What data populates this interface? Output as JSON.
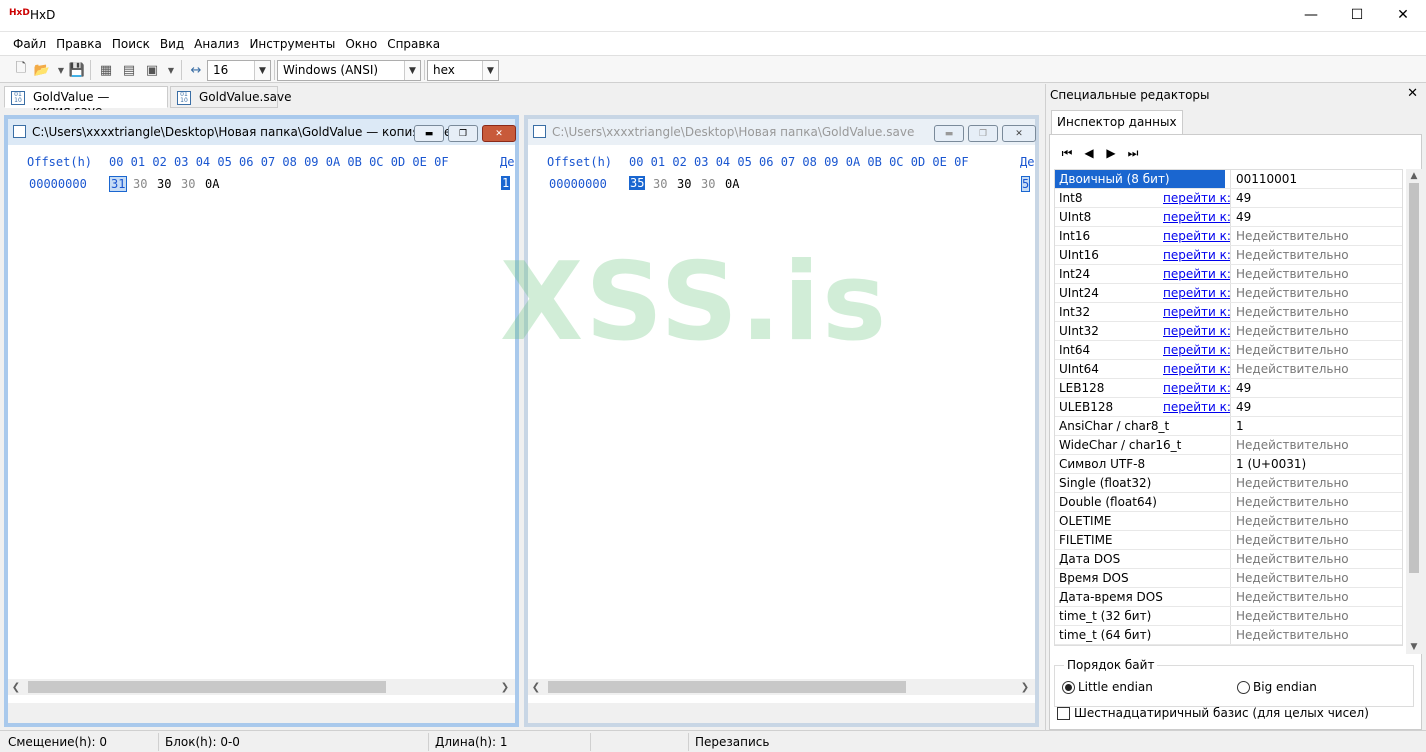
{
  "app": {
    "title": "HxD",
    "icon": "hxd-app-icon"
  },
  "window_controls": {
    "minimize": "—",
    "maximize": "☐",
    "close": "✕"
  },
  "menu": [
    "Файл",
    "Правка",
    "Поиск",
    "Вид",
    "Анализ",
    "Инструменты",
    "Окно",
    "Справка"
  ],
  "toolbar": {
    "bytes_per_row": "16",
    "charset": "Windows (ANSI)",
    "offset_base": "hex"
  },
  "tabs": [
    {
      "label": "GoldValue — копия.save",
      "active": true
    },
    {
      "label": "GoldValue.save",
      "active": false
    }
  ],
  "editors": [
    {
      "path": "C:\\Users\\xxxxtriangle\\Desktop\\Новая папка\\GoldValue — копия.save",
      "header_offset": "Offset(h)",
      "header_cols": "00 01 02 03 04 05 06 07 08 09 0A 0B 0C 0D 0E 0F",
      "header_decoded": "Де",
      "row_offset": "00000000",
      "bytes": [
        "31",
        "30",
        "30",
        "30",
        "0A"
      ],
      "decoded_cursor": "1"
    },
    {
      "path": "C:\\Users\\xxxxtriangle\\Desktop\\Новая папка\\GoldValue.save",
      "header_offset": "Offset(h)",
      "header_cols": "00 01 02 03 04 05 06 07 08 09 0A 0B 0C 0D 0E 0F",
      "header_decoded": "Де",
      "row_offset": "00000000",
      "bytes": [
        "35",
        "30",
        "30",
        "30",
        "0A"
      ],
      "decoded_cursor": "5"
    }
  ],
  "watermark": "XSS.is",
  "right_panel": {
    "title": "Специальные редакторы",
    "close": "✕",
    "tab": "Инспектор данных",
    "goto_label": "перейти к:",
    "rows": [
      {
        "name": "Двоичный (8 бит)",
        "value": "00110001",
        "goto": false,
        "selected": true
      },
      {
        "name": "Int8",
        "value": "49",
        "goto": true
      },
      {
        "name": "UInt8",
        "value": "49",
        "goto": true
      },
      {
        "name": "Int16",
        "value": "Недействительно",
        "goto": true
      },
      {
        "name": "UInt16",
        "value": "Недействительно",
        "goto": true
      },
      {
        "name": "Int24",
        "value": "Недействительно",
        "goto": true
      },
      {
        "name": "UInt24",
        "value": "Недействительно",
        "goto": true
      },
      {
        "name": "Int32",
        "value": "Недействительно",
        "goto": true
      },
      {
        "name": "UInt32",
        "value": "Недействительно",
        "goto": true
      },
      {
        "name": "Int64",
        "value": "Недействительно",
        "goto": true
      },
      {
        "name": "UInt64",
        "value": "Недействительно",
        "goto": true
      },
      {
        "name": "LEB128",
        "value": "49",
        "goto": true
      },
      {
        "name": "ULEB128",
        "value": "49",
        "goto": true
      },
      {
        "name": "AnsiChar / char8_t",
        "value": "1",
        "goto": false
      },
      {
        "name": "WideChar / char16_t",
        "value": "Недействительно",
        "goto": false
      },
      {
        "name": "Символ UTF-8",
        "value": "1 (U+0031)",
        "goto": false
      },
      {
        "name": "Single (float32)",
        "value": "Недействительно",
        "goto": false
      },
      {
        "name": "Double (float64)",
        "value": "Недействительно",
        "goto": false
      },
      {
        "name": "OLETIME",
        "value": "Недействительно",
        "goto": false
      },
      {
        "name": "FILETIME",
        "value": "Недействительно",
        "goto": false
      },
      {
        "name": "Дата DOS",
        "value": "Недействительно",
        "goto": false
      },
      {
        "name": "Время DOS",
        "value": "Недействительно",
        "goto": false
      },
      {
        "name": "Дата-время DOS",
        "value": "Недействительно",
        "goto": false
      },
      {
        "name": "time_t (32 бит)",
        "value": "Недействительно",
        "goto": false
      },
      {
        "name": "time_t (64 бит)",
        "value": "Недействительно",
        "goto": false
      }
    ],
    "byte_order": {
      "title": "Порядок байт",
      "little": "Little endian",
      "big": "Big endian",
      "selected": "little"
    },
    "hex_basis": "Шестнадцатиричный базис (для целых чисел)"
  },
  "status": {
    "offset": "Смещение(h): 0",
    "block": "Блок(h): 0-0",
    "length": "Длина(h): 1",
    "mode": "Перезапись"
  }
}
